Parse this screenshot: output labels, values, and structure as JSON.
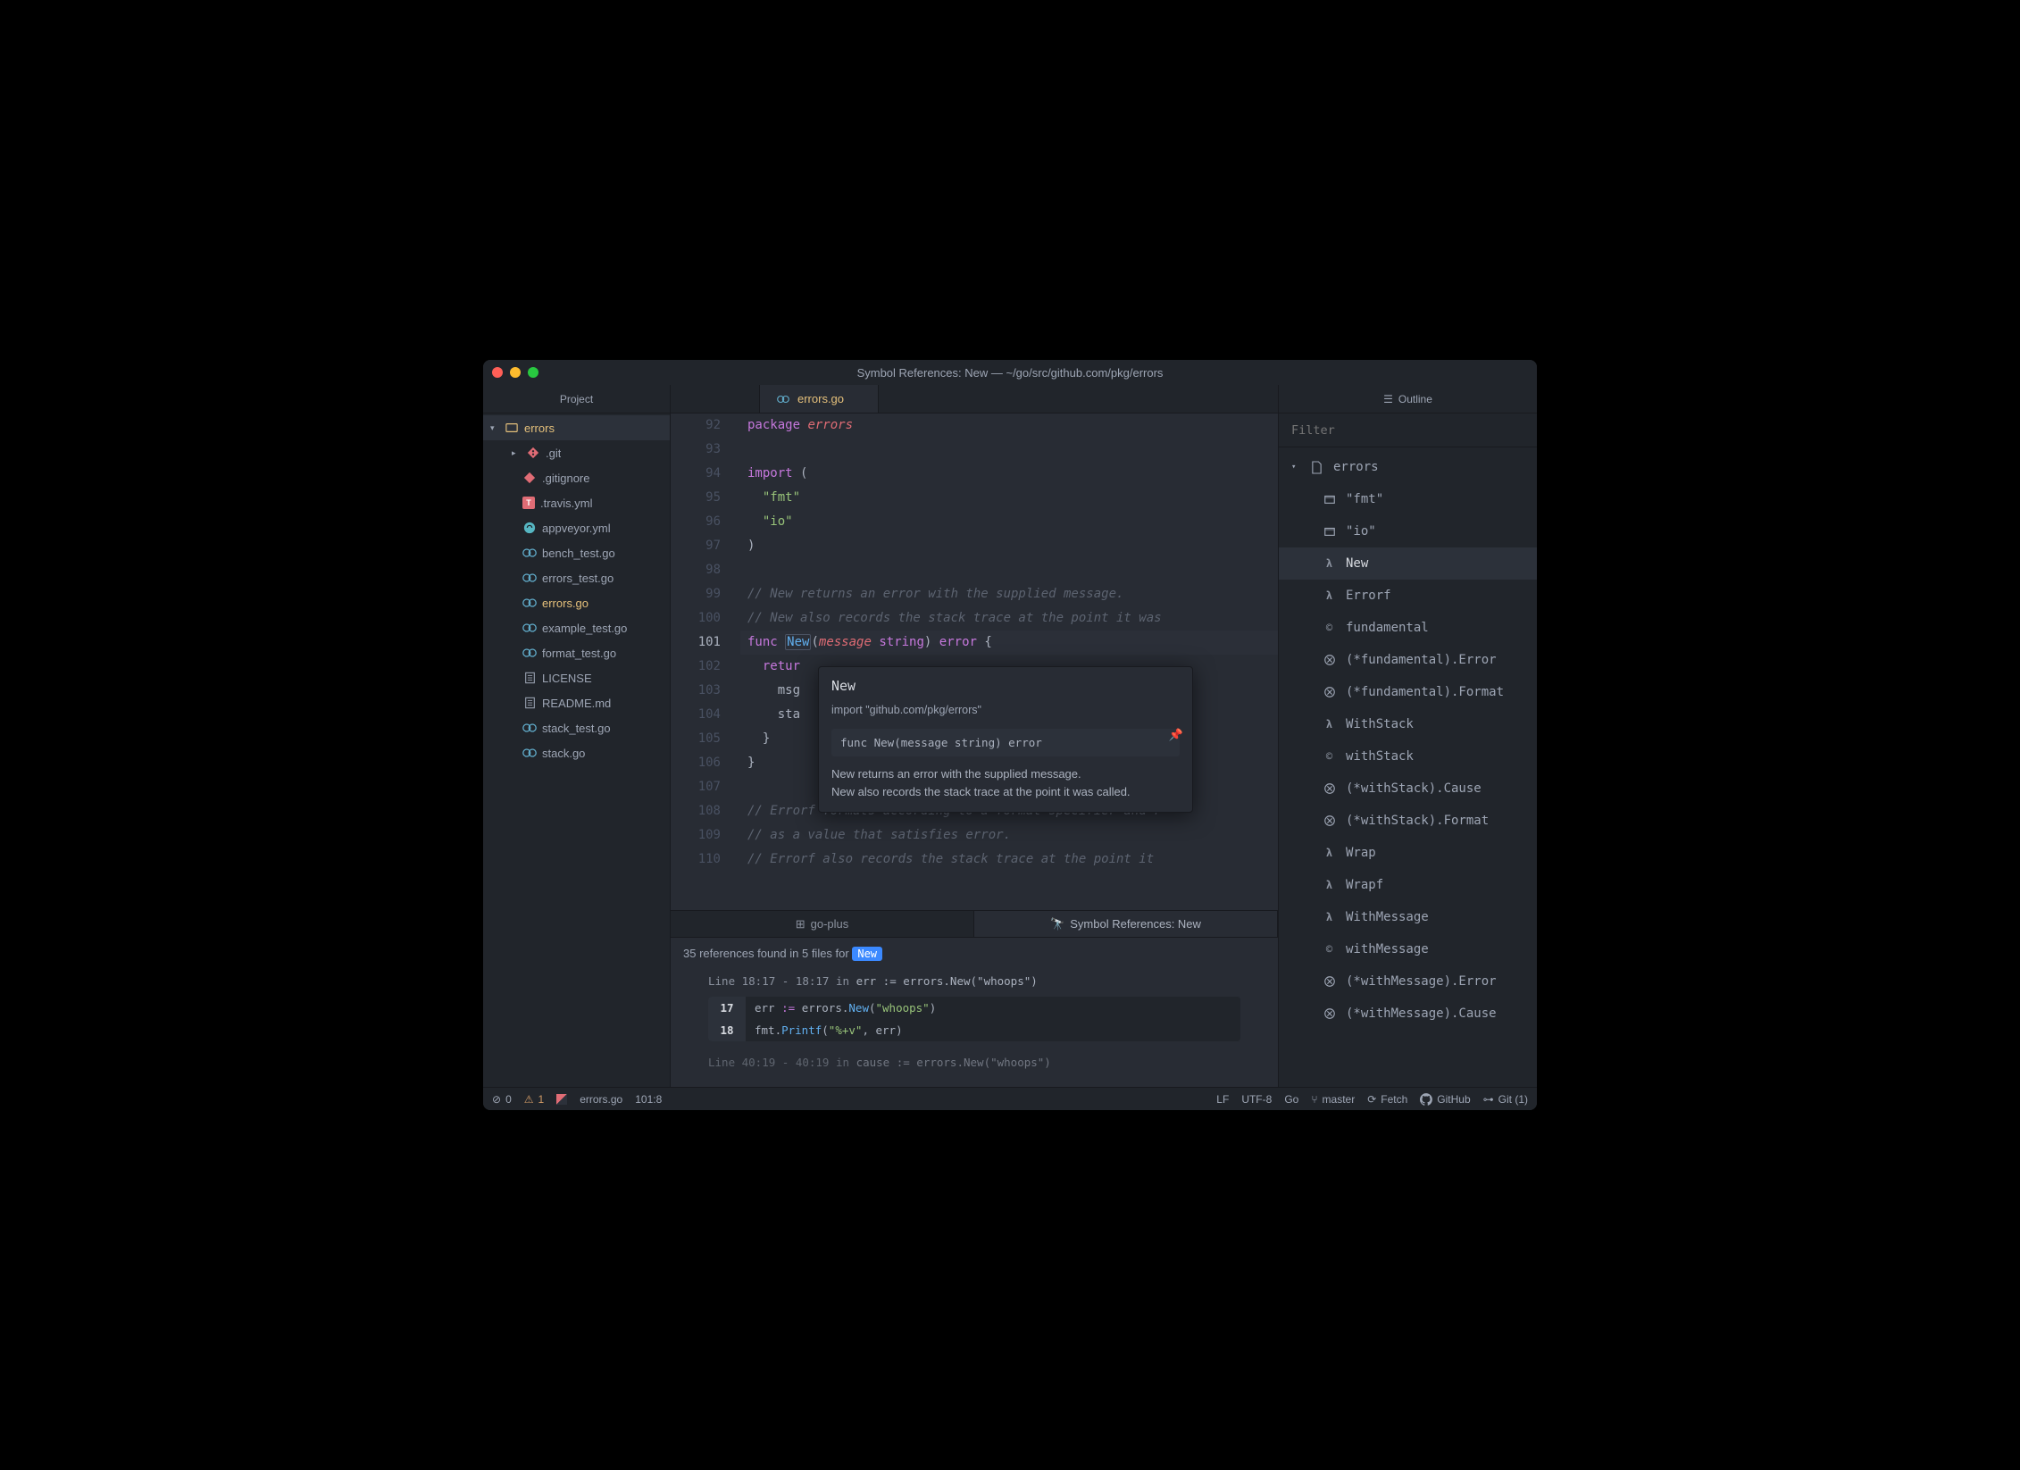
{
  "titlebar": {
    "title": "Symbol References: New — ~/go/src/github.com/pkg/errors"
  },
  "project": {
    "header": "Project",
    "root": "errors",
    "items": [
      {
        "icon": "git",
        "label": ".git",
        "chev": ">"
      },
      {
        "icon": "gitignore",
        "label": ".gitignore"
      },
      {
        "icon": "travis",
        "label": ".travis.yml"
      },
      {
        "icon": "appveyor",
        "label": "appveyor.yml"
      },
      {
        "icon": "go",
        "label": "bench_test.go"
      },
      {
        "icon": "go",
        "label": "errors_test.go"
      },
      {
        "icon": "go",
        "label": "errors.go",
        "modified": true
      },
      {
        "icon": "go",
        "label": "example_test.go"
      },
      {
        "icon": "go",
        "label": "format_test.go"
      },
      {
        "icon": "text",
        "label": "LICENSE"
      },
      {
        "icon": "text",
        "label": "README.md"
      },
      {
        "icon": "go",
        "label": "stack_test.go"
      },
      {
        "icon": "go",
        "label": "stack.go"
      }
    ]
  },
  "editor": {
    "tab_label": "errors.go",
    "first_line": 92,
    "current_line": 101,
    "lines": [
      [
        {
          "t": "kw",
          "v": "package"
        },
        {
          "t": "plain",
          "v": " "
        },
        {
          "t": "pkg",
          "v": "errors"
        }
      ],
      [],
      [
        {
          "t": "kw",
          "v": "import"
        },
        {
          "t": "plain",
          "v": " ("
        }
      ],
      [
        {
          "t": "invis",
          "v": "  "
        },
        {
          "t": "str",
          "v": "\"fmt\""
        }
      ],
      [
        {
          "t": "invis",
          "v": "  "
        },
        {
          "t": "str",
          "v": "\"io\""
        }
      ],
      [
        {
          "t": "plain",
          "v": ")"
        }
      ],
      [],
      [
        {
          "t": "comment",
          "v": "// New returns an error with the supplied message."
        }
      ],
      [
        {
          "t": "comment",
          "v": "// New also records the stack trace at the point it was"
        }
      ],
      [
        {
          "t": "kw",
          "v": "func"
        },
        {
          "t": "plain",
          "v": " "
        },
        {
          "t": "fn box",
          "v": "New"
        },
        {
          "t": "plain",
          "v": "("
        },
        {
          "t": "param",
          "v": "message"
        },
        {
          "t": "plain",
          "v": " "
        },
        {
          "t": "type",
          "v": "string"
        },
        {
          "t": "plain",
          "v": ") "
        },
        {
          "t": "type",
          "v": "error"
        },
        {
          "t": "plain",
          "v": " {"
        }
      ],
      [
        {
          "t": "invis",
          "v": "  "
        },
        {
          "t": "kw",
          "v": "retur"
        }
      ],
      [
        {
          "t": "invis",
          "v": "    "
        },
        {
          "t": "plain",
          "v": "msg"
        }
      ],
      [
        {
          "t": "invis",
          "v": "    "
        },
        {
          "t": "plain",
          "v": "sta"
        }
      ],
      [
        {
          "t": "invis",
          "v": "  "
        },
        {
          "t": "plain",
          "v": "}"
        }
      ],
      [
        {
          "t": "plain",
          "v": "}"
        }
      ],
      [],
      [
        {
          "t": "comment",
          "v": "// Errorf formats according to a format specifier and r"
        }
      ],
      [
        {
          "t": "comment",
          "v": "// as a value that satisfies error."
        }
      ],
      [
        {
          "t": "comment",
          "v": "// Errorf also records the stack trace at the point it "
        }
      ]
    ]
  },
  "popover": {
    "title": "New",
    "import": "import \"github.com/pkg/errors\"",
    "signature": "func New(message string) error",
    "desc1": "New returns an error with the supplied message.",
    "desc2": "New also records the stack trace at the point it was called."
  },
  "bottom": {
    "tab1": "go-plus",
    "tab2": "Symbol References: New",
    "summary_prefix": "35 references found in 5 files for ",
    "summary_badge": "New",
    "ref1": {
      "title_prefix": "Line 18:17 - 18:17 in ",
      "title_code": "err := errors.New(\"whoops\")",
      "rows": [
        {
          "n": "17",
          "code": [
            {
              "t": "plain",
              "v": "err "
            },
            {
              "t": "kw",
              "v": ":="
            },
            {
              "t": "plain",
              "v": " errors."
            },
            {
              "t": "fn",
              "v": "New"
            },
            {
              "t": "plain",
              "v": "("
            },
            {
              "t": "str",
              "v": "\"whoops\""
            },
            {
              "t": "plain",
              "v": ")"
            }
          ]
        },
        {
          "n": "18",
          "code": [
            {
              "t": "plain",
              "v": "fmt."
            },
            {
              "t": "fn",
              "v": "Printf"
            },
            {
              "t": "plain",
              "v": "("
            },
            {
              "t": "str",
              "v": "\"%+v\""
            },
            {
              "t": "plain",
              "v": ", err)"
            }
          ]
        }
      ]
    },
    "ref2": {
      "title_prefix": "Line 40:19 - 40:19 in ",
      "title_code": "cause := errors.New(\"whoops\")"
    }
  },
  "outline": {
    "header": "Outline",
    "filter_placeholder": "Filter",
    "root": "errors",
    "items": [
      {
        "icon": "pkg",
        "label": "\"fmt\""
      },
      {
        "icon": "pkg",
        "label": "\"io\""
      },
      {
        "icon": "lambda",
        "label": "New",
        "selected": true
      },
      {
        "icon": "lambda",
        "label": "Errorf"
      },
      {
        "icon": "copyright",
        "label": "fundamental"
      },
      {
        "icon": "method",
        "label": "(*fundamental).Error"
      },
      {
        "icon": "method",
        "label": "(*fundamental).Format"
      },
      {
        "icon": "lambda",
        "label": "WithStack"
      },
      {
        "icon": "copyright",
        "label": "withStack"
      },
      {
        "icon": "method",
        "label": "(*withStack).Cause"
      },
      {
        "icon": "method",
        "label": "(*withStack).Format"
      },
      {
        "icon": "lambda",
        "label": "Wrap"
      },
      {
        "icon": "lambda",
        "label": "Wrapf"
      },
      {
        "icon": "lambda",
        "label": "WithMessage"
      },
      {
        "icon": "copyright",
        "label": "withMessage"
      },
      {
        "icon": "method",
        "label": "(*withMessage).Error"
      },
      {
        "icon": "method",
        "label": "(*withMessage).Cause"
      }
    ]
  },
  "statusbar": {
    "errors": "0",
    "warnings": "1",
    "file": "errors.go",
    "pos": "101:8",
    "eol": "LF",
    "encoding": "UTF-8",
    "lang": "Go",
    "branch": "master",
    "fetch": "Fetch",
    "github": "GitHub",
    "git": "Git (1)"
  }
}
